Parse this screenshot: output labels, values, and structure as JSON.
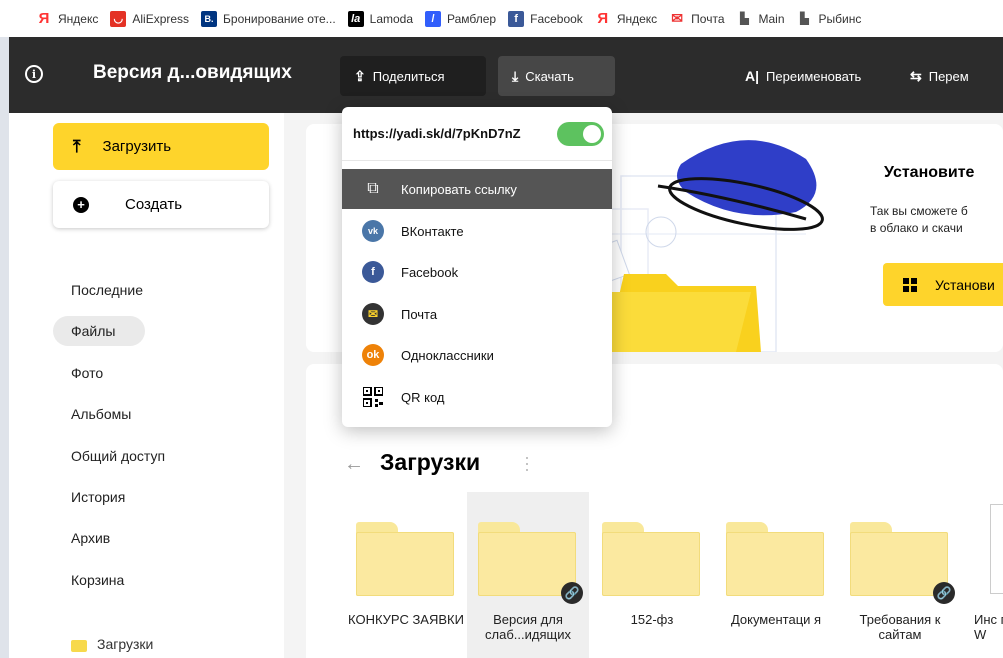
{
  "bookmarks": [
    {
      "label": "Яндекс",
      "icon": "yandex-icon",
      "color": "#f33"
    },
    {
      "label": "AliExpress",
      "icon": "aliexpress-icon",
      "color": "#e43225"
    },
    {
      "label": "Бронирование оте...",
      "icon": "booking-icon",
      "color": "#003580"
    },
    {
      "label": "Lamoda",
      "icon": "lamoda-icon",
      "color": "#000"
    },
    {
      "label": "Рамблер",
      "icon": "rambler-icon",
      "color": "#315efb"
    },
    {
      "label": "Facebook",
      "icon": "facebook-icon",
      "color": "#3b5998"
    },
    {
      "label": "Яндекс",
      "icon": "yandex-icon",
      "color": "#f33"
    },
    {
      "label": "Почта",
      "icon": "mail-icon",
      "color": "#fed42b"
    },
    {
      "label": "Main",
      "icon": "document-icon",
      "color": "#555"
    },
    {
      "label": "Рыбинс",
      "icon": "document-icon",
      "color": "#555"
    }
  ],
  "bookmark_glyphs": [
    "Я",
    "◡",
    "B.",
    "la",
    "/",
    "f",
    "Я",
    "✉",
    "▙",
    "▙"
  ],
  "toolbar": {
    "title": "Версия д...овидящих",
    "info_glyph": "i",
    "share_label": "Поделиться",
    "download_label": "Скачать",
    "rename_label": "Переименовать",
    "move_label": "Перем"
  },
  "sidebar": {
    "upload_label": "Загрузить",
    "create_label": "Создать",
    "items": [
      "Последние",
      "Файлы",
      "Фото",
      "Альбомы",
      "Общий доступ",
      "История",
      "Архив",
      "Корзина"
    ],
    "active_item": "Файлы",
    "folder_label": "Загрузки"
  },
  "promo": {
    "title": "Установите",
    "text_line1": "Так вы сможете б",
    "text_line2": "в облако и скачи",
    "install_label": "Установи"
  },
  "files": {
    "title": "Загрузки",
    "items": [
      {
        "name": "КОНКУРС ЗАЯВКИ",
        "shared": false,
        "selected": false
      },
      {
        "name": "Версия для слаб...идящих",
        "shared": true,
        "selected": true
      },
      {
        "name": "152-фз",
        "shared": false,
        "selected": false
      },
      {
        "name": "Документаци я",
        "shared": false,
        "selected": false
      },
      {
        "name": "Требования к сайтам",
        "shared": true,
        "selected": false
      },
      {
        "name": "Инс по W",
        "shared": false,
        "selected": false
      }
    ]
  },
  "share_menu": {
    "link": "https://yadi.sk/d/7pKnD7nZ",
    "public_enabled": true,
    "items": [
      {
        "label": "Копировать ссылку",
        "icon": "copy-icon",
        "color": "#555",
        "highlighted": true
      },
      {
        "label": "ВКонтакте",
        "icon": "vk-icon",
        "color": "#4a76a8",
        "highlighted": false
      },
      {
        "label": "Facebook",
        "icon": "facebook-icon",
        "color": "#3b5998",
        "highlighted": false
      },
      {
        "label": "Почта",
        "icon": "mail-icon",
        "color": "#f33",
        "highlighted": false
      },
      {
        "label": "Одноклассники",
        "icon": "odnoklassniki-icon",
        "color": "#ee8208",
        "highlighted": false
      },
      {
        "label": "QR код",
        "icon": "qr-code-icon",
        "color": "#000",
        "highlighted": false
      }
    ]
  },
  "colors": {
    "accent": "#fed42b",
    "toolbar_bg": "#2c2c2c",
    "toggle_on": "#5dc25f"
  }
}
